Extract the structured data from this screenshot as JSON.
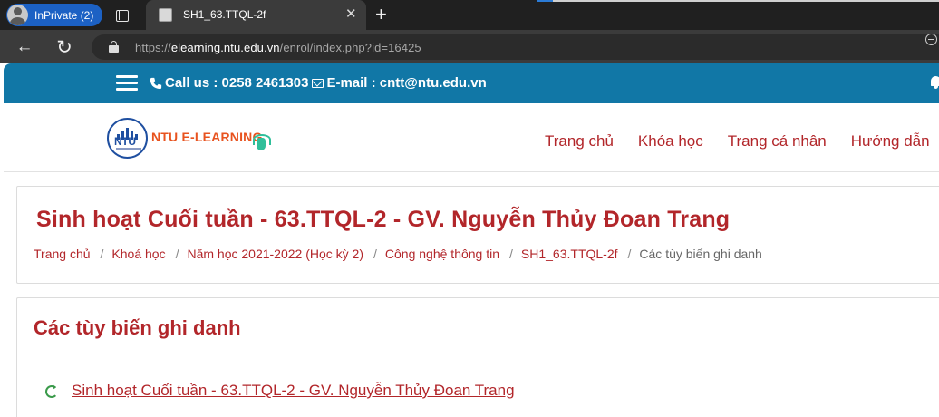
{
  "browser": {
    "inprivate_label": "InPrivate (2)",
    "tab_title": "SH1_63.TTQL-2f",
    "tab_close": "✕",
    "new_tab": "+",
    "url_prefix": "https://",
    "url_host": "elearning.ntu.edu.vn",
    "url_path": "/enrol/index.php?id=16425",
    "back_icon": "←",
    "refresh_icon": "↻"
  },
  "site": {
    "contact_phone": "Call us : 0258 2461303",
    "contact_email": "E-mail : cntt@ntu.edu.vn",
    "logo_text": "NTU E-LEARNING",
    "logo_mark": "NTU",
    "menu": [
      "Trang chủ",
      "Khóa học",
      "Trang cá nhân",
      "Hướng dẫn"
    ]
  },
  "course": {
    "title": "Sinh hoạt Cuối tuần - 63.TTQL-2 - GV. Nguyễn Thủy Đoan Trang",
    "breadcrumb": [
      "Trang chủ",
      "Khoá học",
      "Năm học 2021-2022 (Học kỳ 2)",
      "Công nghệ thông tin",
      "SH1_63.TTQL-2f",
      "Các tùy biến ghi danh"
    ],
    "breadcrumb_sep": "/"
  },
  "enrolment": {
    "heading": "Các tùy biến ghi danh",
    "course_link": "Sinh hoạt Cuối tuần - 63.TTQL-2 - GV. Nguyễn Thủy Đoan Trang"
  },
  "colors": {
    "topbar": "#1177a6",
    "accent": "#b2262a",
    "logo_orange": "#e8531f"
  }
}
